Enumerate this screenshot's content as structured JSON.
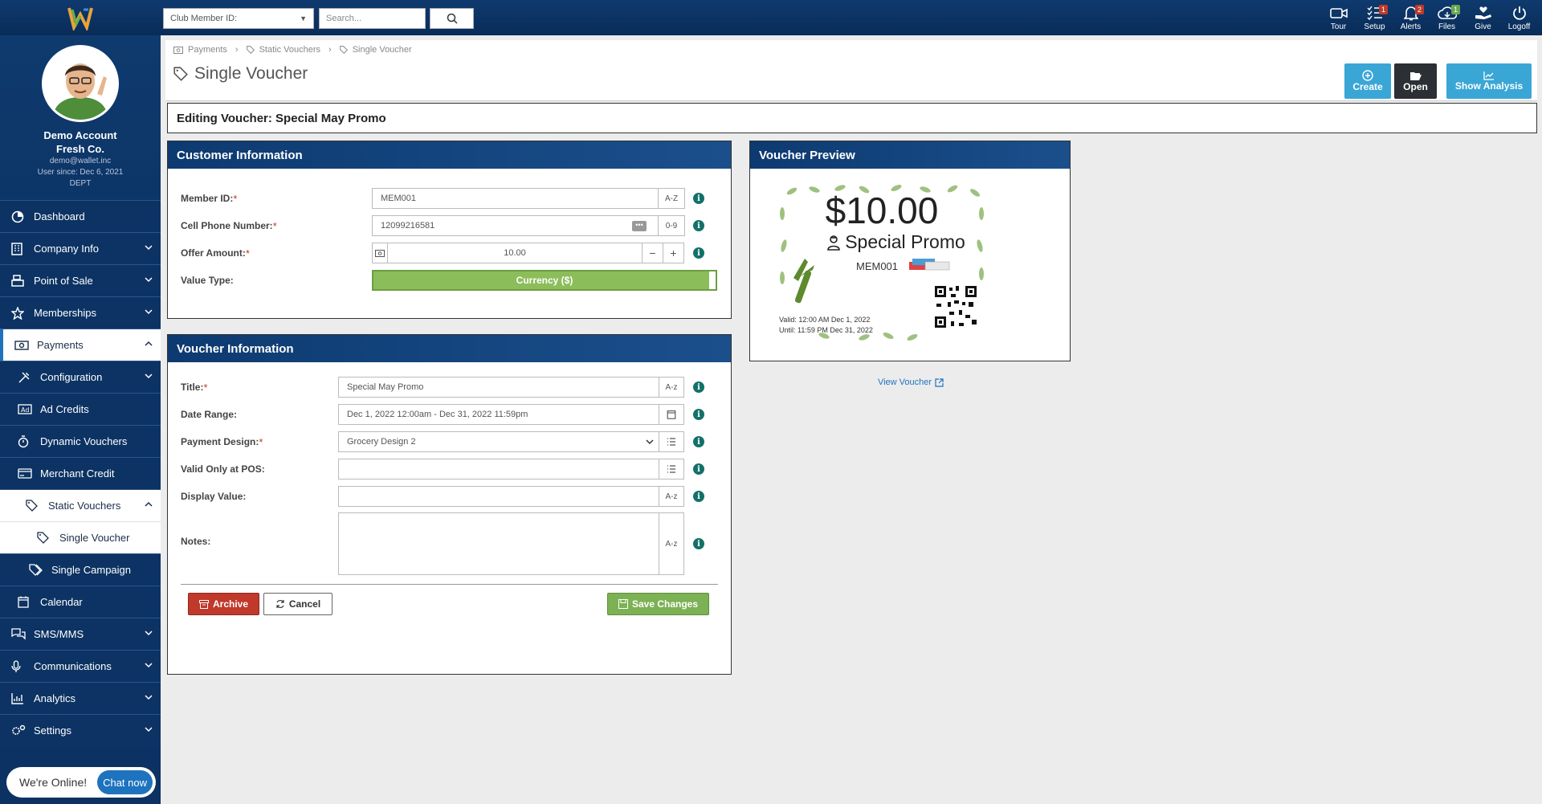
{
  "topbar": {
    "club_select": "Club Member ID:",
    "search_placeholder": "Search...",
    "actions": [
      {
        "label": "Tour",
        "icon": "video-icon",
        "badge": ""
      },
      {
        "label": "Setup",
        "icon": "checklist-icon",
        "badge": "1"
      },
      {
        "label": "Alerts",
        "icon": "bell-icon",
        "badge": "2"
      },
      {
        "label": "Files",
        "icon": "cloud-icon",
        "badge": "1"
      },
      {
        "label": "Give",
        "icon": "heart-hand-icon",
        "badge": ""
      },
      {
        "label": "Logoff",
        "icon": "power-icon",
        "badge": ""
      }
    ]
  },
  "profile": {
    "name1": "Demo Account",
    "name2": "Fresh Co.",
    "email": "demo@wallet.inc",
    "since": "User since: Dec 6, 2021",
    "dept": "DEPT"
  },
  "nav": {
    "dashboard": "Dashboard",
    "company_info": "Company Info",
    "pos": "Point of Sale",
    "memberships": "Memberships",
    "payments": "Payments",
    "configuration": "Configuration",
    "ad_credits": "Ad Credits",
    "dynamic_vouchers": "Dynamic Vouchers",
    "merchant_credit": "Merchant Credit",
    "static_vouchers": "Static Vouchers",
    "single_voucher": "Single Voucher",
    "single_campaign": "Single Campaign",
    "calendar": "Calendar",
    "sms": "SMS/MMS",
    "communications": "Communications",
    "analytics": "Analytics",
    "settings": "Settings"
  },
  "chat": {
    "text": "We're Online!",
    "button": "Chat now"
  },
  "breadcrumb": [
    "Payments",
    "Static Vouchers",
    "Single Voucher"
  ],
  "page_title": "Single Voucher",
  "header_buttons": {
    "create": "Create",
    "open": "Open",
    "analysis": "Show Analysis"
  },
  "edit_bar": "Editing Voucher: Special May Promo",
  "customer": {
    "title": "Customer Information",
    "member_id_label": "Member ID:",
    "member_id": "MEM001",
    "member_addon": "A-Z",
    "phone_label": "Cell Phone Number:",
    "phone": "12099216581",
    "phone_addon": "0-9",
    "offer_label": "Offer Amount:",
    "offer": "10.00",
    "value_type_label": "Value Type:",
    "value_type": "Currency ($)"
  },
  "voucher_info": {
    "title": "Voucher Information",
    "title_label": "Title:",
    "title_value": "Special May Promo",
    "date_label": "Date Range:",
    "date_value": "Dec 1, 2022 12:00am - Dec 31, 2022 11:59pm",
    "design_label": "Payment Design:",
    "design_value": "Grocery Design 2",
    "pos_label": "Valid Only at POS:",
    "display_label": "Display Value:",
    "notes_label": "Notes:",
    "addon": "A-z"
  },
  "buttons": {
    "archive": "Archive",
    "cancel": "Cancel",
    "save": "Save Changes"
  },
  "preview": {
    "title": "Voucher Preview",
    "amount": "$10.00",
    "name": "Special Promo",
    "member": "MEM001",
    "valid": "Valid: 12:00 AM Dec 1, 2022",
    "until": "Until: 11:59 PM Dec 31, 2022",
    "link": "View Voucher"
  }
}
